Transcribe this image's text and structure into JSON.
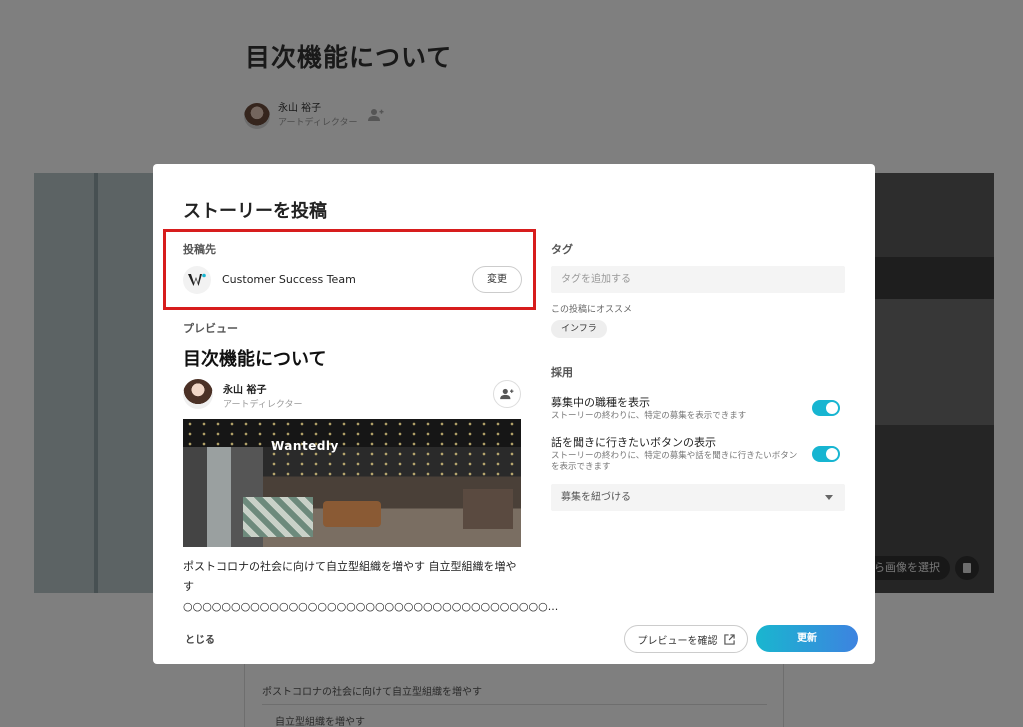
{
  "background_page": {
    "title": "目次機能について",
    "author_name": "永山 裕子",
    "author_role": "アートディレクター",
    "hero_select_label": "ら画像を選択",
    "body_line1": "ポストコロナの社会に向けて自立型組織を増やす",
    "body_line2": "自立型組織を増やす"
  },
  "modal": {
    "title": "ストーリーを投稿",
    "destination": {
      "label": "投稿先",
      "name": "Customer Success Team",
      "change_label": "変更"
    },
    "preview": {
      "label": "プレビュー",
      "title": "目次機能について",
      "author_name": "永山 裕子",
      "author_role": "アートディレクター",
      "image_brand": "Wantedly",
      "body": "ポストコロナの社会に向けて自立型組織を増やす 自立型組織を増やす ○○○○○○○○○○○○○○○○○○○○○○○○○○○○○○○○○○○○○○..."
    },
    "tags": {
      "label": "タグ",
      "placeholder": "タグを追加する",
      "recommend_label": "この投稿にオススメ",
      "recommended": [
        "インフラ"
      ]
    },
    "recruiting": {
      "label": "採用",
      "toggles": [
        {
          "title": "募集中の職種を表示",
          "description": "ストーリーの終わりに、特定の募集を表示できます",
          "on": true
        },
        {
          "title": "話を聞きに行きたいボタンの表示",
          "description": "ストーリーの終わりに、特定の募集や話を聞きに行きたいボタンを表示できます",
          "on": true
        }
      ],
      "link_select": "募集を紐づける"
    },
    "footer": {
      "close_label": "とじる",
      "preview_label": "プレビューを確認",
      "update_label": "更新"
    }
  },
  "colors": {
    "toggle_on": "#17b5d1",
    "update_gradient_start": "#19b6cf",
    "update_gradient_end": "#3d83e0",
    "highlight": "#d71d1d"
  }
}
